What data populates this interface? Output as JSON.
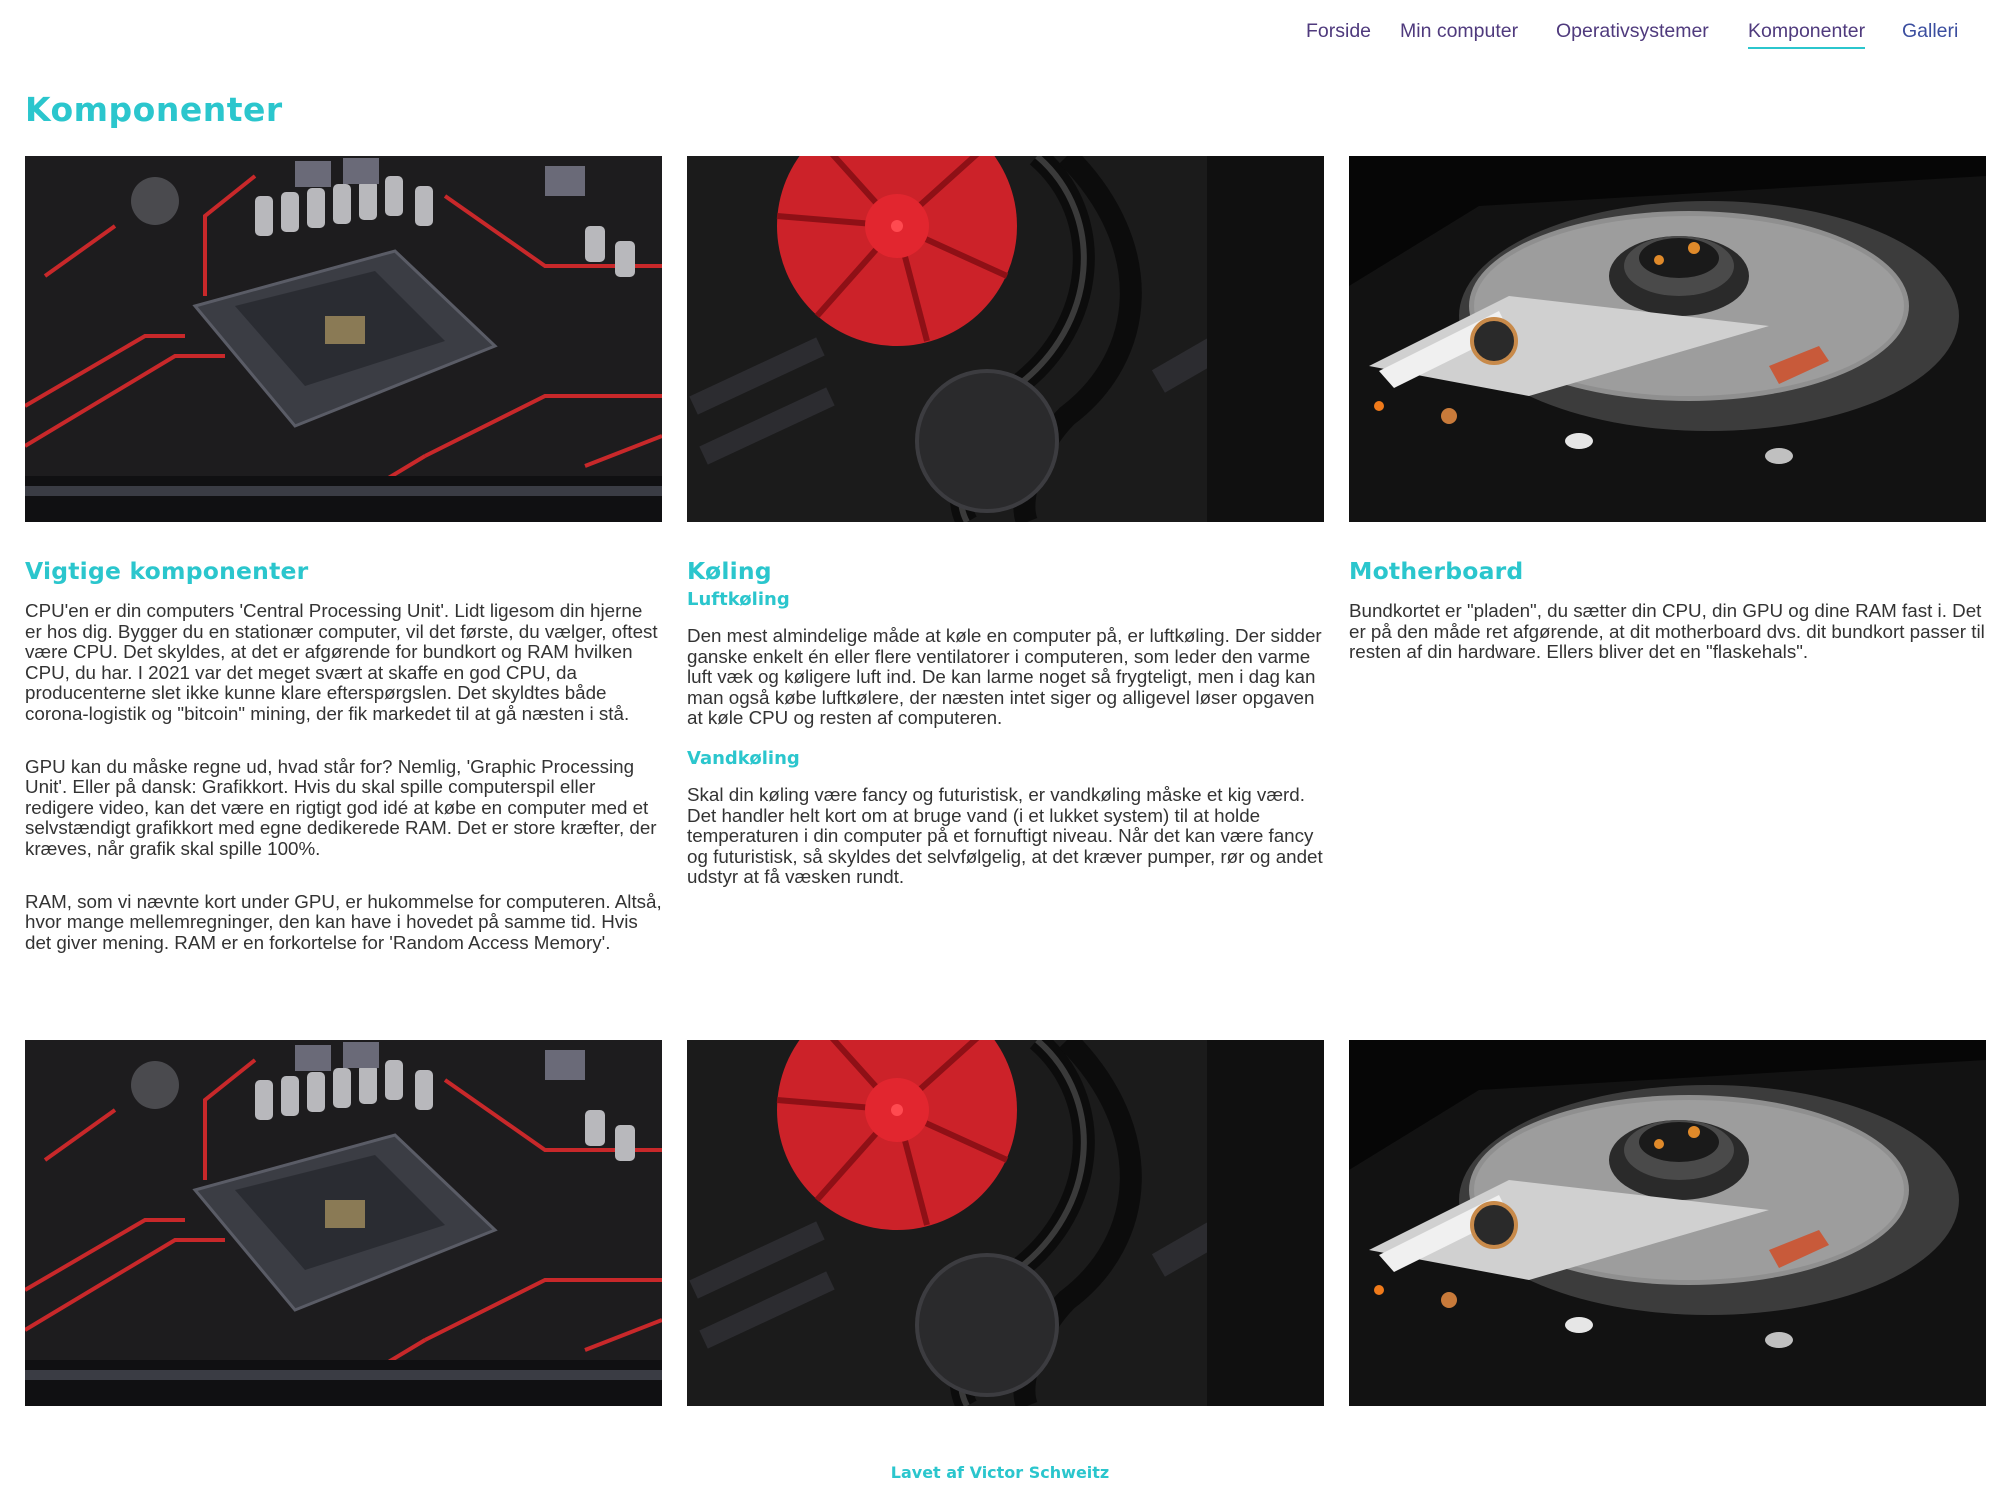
{
  "nav": {
    "items": [
      {
        "label": "Forside"
      },
      {
        "label": "Min computer"
      },
      {
        "label": "Operativsystemer"
      },
      {
        "label": "Komponenter"
      },
      {
        "label": "Galleri"
      }
    ],
    "active_index": 3
  },
  "page": {
    "title": "Komponenter"
  },
  "sections": {
    "vigtige": {
      "heading": "Vigtige komponenter",
      "paragraphs": [
        "CPU'en er din computers 'Central Processing Unit'. Lidt ligesom din hjerne er hos dig. Bygger du en stationær computer, vil det første, du vælger, oftest være CPU. Det skyldes, at det er afgørende for bundkort og RAM hvilken CPU, du har. I 2021 var det meget svært at skaffe en god CPU, da producenterne slet ikke kunne klare efterspørgslen. Det skyldtes både corona-logistik og \"bitcoin\" mining, der fik markedet til at gå næsten i stå.",
        "GPU kan du måske regne ud, hvad står for? Nemlig, 'Graphic Processing Unit'. Eller på dansk: Grafikkort. Hvis du skal spille computerspil eller redigere video, kan det være en rigtigt god idé at købe en computer med et selvstændigt grafikkort med egne dedikerede RAM. Det er store kræfter, der kræves, når grafik skal spille 100%.",
        "RAM, som vi nævnte kort under GPU, er hukommelse for computeren. Altså, hvor mange mellemregninger, den kan have i hovedet på samme tid. Hvis det giver mening. RAM er en forkortelse for 'Random Access Memory'."
      ]
    },
    "koling": {
      "heading": "Køling",
      "sub1": "Luftkøling",
      "p1": "Den mest almindelige måde at køle en computer på, er luftkøling. Der sidder ganske enkelt én eller flere ventilatorer i computeren, som leder den varme luft væk og køligere luft ind. De kan larme noget så frygteligt, men i dag kan man også købe luftkølere, der næsten intet siger og alligevel løser opgaven at køle CPU og resten af computeren.",
      "sub2": "Vandkøling",
      "p2": "Skal din køling være fancy og futuristisk, er vandkøling måske et kig værd. Det handler helt kort om at bruge vand (i et lukket system) til at holde temperaturen i din computer på et fornuftigt niveau. Når det kan være fancy og futuristisk, så skyldes det selvfølgelig, at det kræver pumper, rør og andet udstyr at få væsken rundt."
    },
    "motherboard": {
      "heading": "Motherboard",
      "p1": "Bundkortet er \"pladen\", du sætter din CPU, din GPU og dine RAM fast i. Det er på den måde ret afgørende, at dit motherboard dvs. dit bundkort passer til resten af din hardware. Ellers bliver det en \"flaskehals\"."
    }
  },
  "images": [
    {
      "icon": "cpu-socket-photo"
    },
    {
      "icon": "red-cpu-cooler-photo"
    },
    {
      "icon": "hard-drive-photo"
    }
  ],
  "colors": {
    "accent": "#2bc6cd",
    "nav_text": "#4f3a7d",
    "body_text": "#333333"
  },
  "footer": {
    "text": "Lavet af Victor Schweitz"
  }
}
